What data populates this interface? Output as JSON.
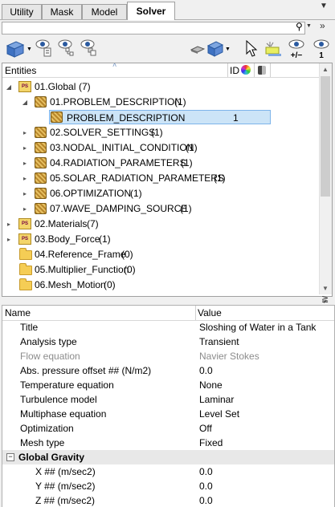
{
  "tabs": [
    {
      "label": "Utility"
    },
    {
      "label": "Mask"
    },
    {
      "label": "Model"
    },
    {
      "label": "Solver"
    }
  ],
  "toolbar_right": {
    "show_label": "1",
    "plusminus_label": "+/−"
  },
  "tree": {
    "header_entities": "Entities",
    "header_id": "ID",
    "nodes": [
      {
        "label": "01.Global",
        "count": "(7)"
      },
      {
        "label": "01.PROBLEM_DESCRIPTION",
        "count": "(1)"
      },
      {
        "label": "PROBLEM_DESCRIPTION",
        "id": "1"
      },
      {
        "label": "02.SOLVER_SETTINGS",
        "count": "(1)"
      },
      {
        "label": "03.NODAL_INITIAL_CONDITION",
        "count": "(1)"
      },
      {
        "label": "04.RADIATION_PARAMETERS",
        "count": "(1)"
      },
      {
        "label": "05.SOLAR_RADIATION_PARAMETERS",
        "count": "(1)"
      },
      {
        "label": "06.OPTIMIZATION",
        "count": "(1)"
      },
      {
        "label": "07.WAVE_DAMPING_SOURCE",
        "count": "(1)"
      },
      {
        "label": "02.Materials",
        "count": "(7)"
      },
      {
        "label": "03.Body_Force",
        "count": "(1)"
      },
      {
        "label": "04.Reference_Frame",
        "count": "(0)"
      },
      {
        "label": "05.Multiplier_Function",
        "count": "(0)"
      },
      {
        "label": "06.Mesh_Motion",
        "count": "(0)"
      }
    ]
  },
  "props": {
    "header_name": "Name",
    "header_value": "Value",
    "rows": [
      {
        "name": "Title",
        "value": "Sloshing of Water in a Tank"
      },
      {
        "name": "Analysis type",
        "value": "Transient"
      },
      {
        "name": "Flow equation",
        "value": "Navier Stokes"
      },
      {
        "name": "Abs. pressure offset ## (N/m2)",
        "value": "0.0"
      },
      {
        "name": "Temperature equation",
        "value": "None"
      },
      {
        "name": "Turbulence model",
        "value": "Laminar"
      },
      {
        "name": "Multiphase equation",
        "value": "Level Set"
      },
      {
        "name": "Optimization",
        "value": "Off"
      },
      {
        "name": "Mesh type",
        "value": "Fixed"
      }
    ],
    "group": {
      "label": "Global Gravity",
      "expander": "−"
    },
    "group_rows": [
      {
        "name": "X ## (m/sec2)",
        "value": "0.0"
      },
      {
        "name": "Y ## (m/sec2)",
        "value": "0.0"
      },
      {
        "name": "Z ## (m/sec2)",
        "value": "0.0"
      }
    ]
  },
  "colors": {
    "selection": "#cce4f7",
    "selection_border": "#7eb4ea",
    "group_bg": "#e8e8e8"
  }
}
